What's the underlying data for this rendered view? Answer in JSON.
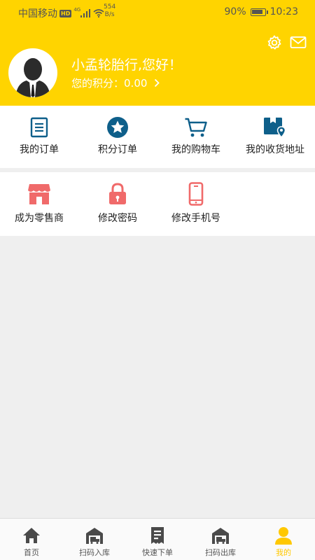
{
  "status_bar": {
    "carrier": "中国移动",
    "hd": "HD",
    "network": "4G",
    "speed_value": "554",
    "speed_unit": "B/s",
    "battery": "90%",
    "battery_level": 0.9,
    "time": "10:23"
  },
  "header": {
    "greeting": "小孟轮胎行,您好！",
    "points_label": "您的积分：",
    "points_value": "0.00",
    "background_color": "#ffd400"
  },
  "menu_row1": [
    {
      "label": "我的订单",
      "icon": "order-list-icon"
    },
    {
      "label": "积分订单",
      "icon": "star-circle-icon"
    },
    {
      "label": "我的购物车",
      "icon": "shopping-cart-icon"
    },
    {
      "label": "我的收货地址",
      "icon": "address-box-icon"
    }
  ],
  "menu_row2": [
    {
      "label": "成为零售商",
      "icon": "store-icon"
    },
    {
      "label": "修改密码",
      "icon": "lock-icon"
    },
    {
      "label": "修改手机号",
      "icon": "phone-icon"
    }
  ],
  "tabbar": [
    {
      "label": "首页",
      "icon": "home-icon"
    },
    {
      "label": "扫码入库",
      "icon": "warehouse-in-icon"
    },
    {
      "label": "快速下单",
      "icon": "receipt-icon"
    },
    {
      "label": "扫码出库",
      "icon": "warehouse-out-icon"
    },
    {
      "label": "我的",
      "icon": "user-icon",
      "active": true
    }
  ],
  "colors": {
    "accent": "#ffd400",
    "icon_blue": "#0e5f8a",
    "icon_red": "#f06a6a",
    "tab_active": "#ffc800"
  }
}
